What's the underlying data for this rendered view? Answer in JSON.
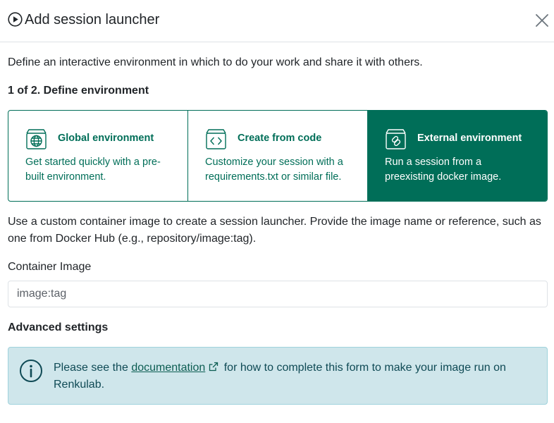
{
  "dialog": {
    "title": "Add session launcher",
    "play_icon": "play-circle-icon",
    "close_icon": "close-icon"
  },
  "intro": "Define an interactive environment in which to do your work and share it with others.",
  "step": "1 of 2. Define environment",
  "environments": [
    {
      "icon": "globe-box-icon",
      "title": "Global environment",
      "description": "Get started quickly with a pre-built environment.",
      "selected": false
    },
    {
      "icon": "code-box-icon",
      "title": "Create from code",
      "description": "Customize your session with a requirements.txt or similar file.",
      "selected": false
    },
    {
      "icon": "link-box-icon",
      "title": "External environment",
      "description": "Run a session from a preexisting docker image.",
      "selected": true
    }
  ],
  "external_description": "Use a custom container image to create a session launcher. Provide the image name or reference, such as one from Docker Hub (e.g., repository/image:tag).",
  "container_image": {
    "label": "Container Image",
    "placeholder": "image:tag",
    "value": ""
  },
  "advanced": "Advanced settings",
  "info": {
    "icon": "info-circle-icon",
    "before": "Please see the",
    "link_text": "documentation",
    "link_icon": "external-link-icon",
    "after": "for how to complete this form to make your image run on Renkulab."
  },
  "colors": {
    "accent": "#006e58",
    "info_bg": "#cfe6eb",
    "info_border": "#9fd2dc"
  }
}
